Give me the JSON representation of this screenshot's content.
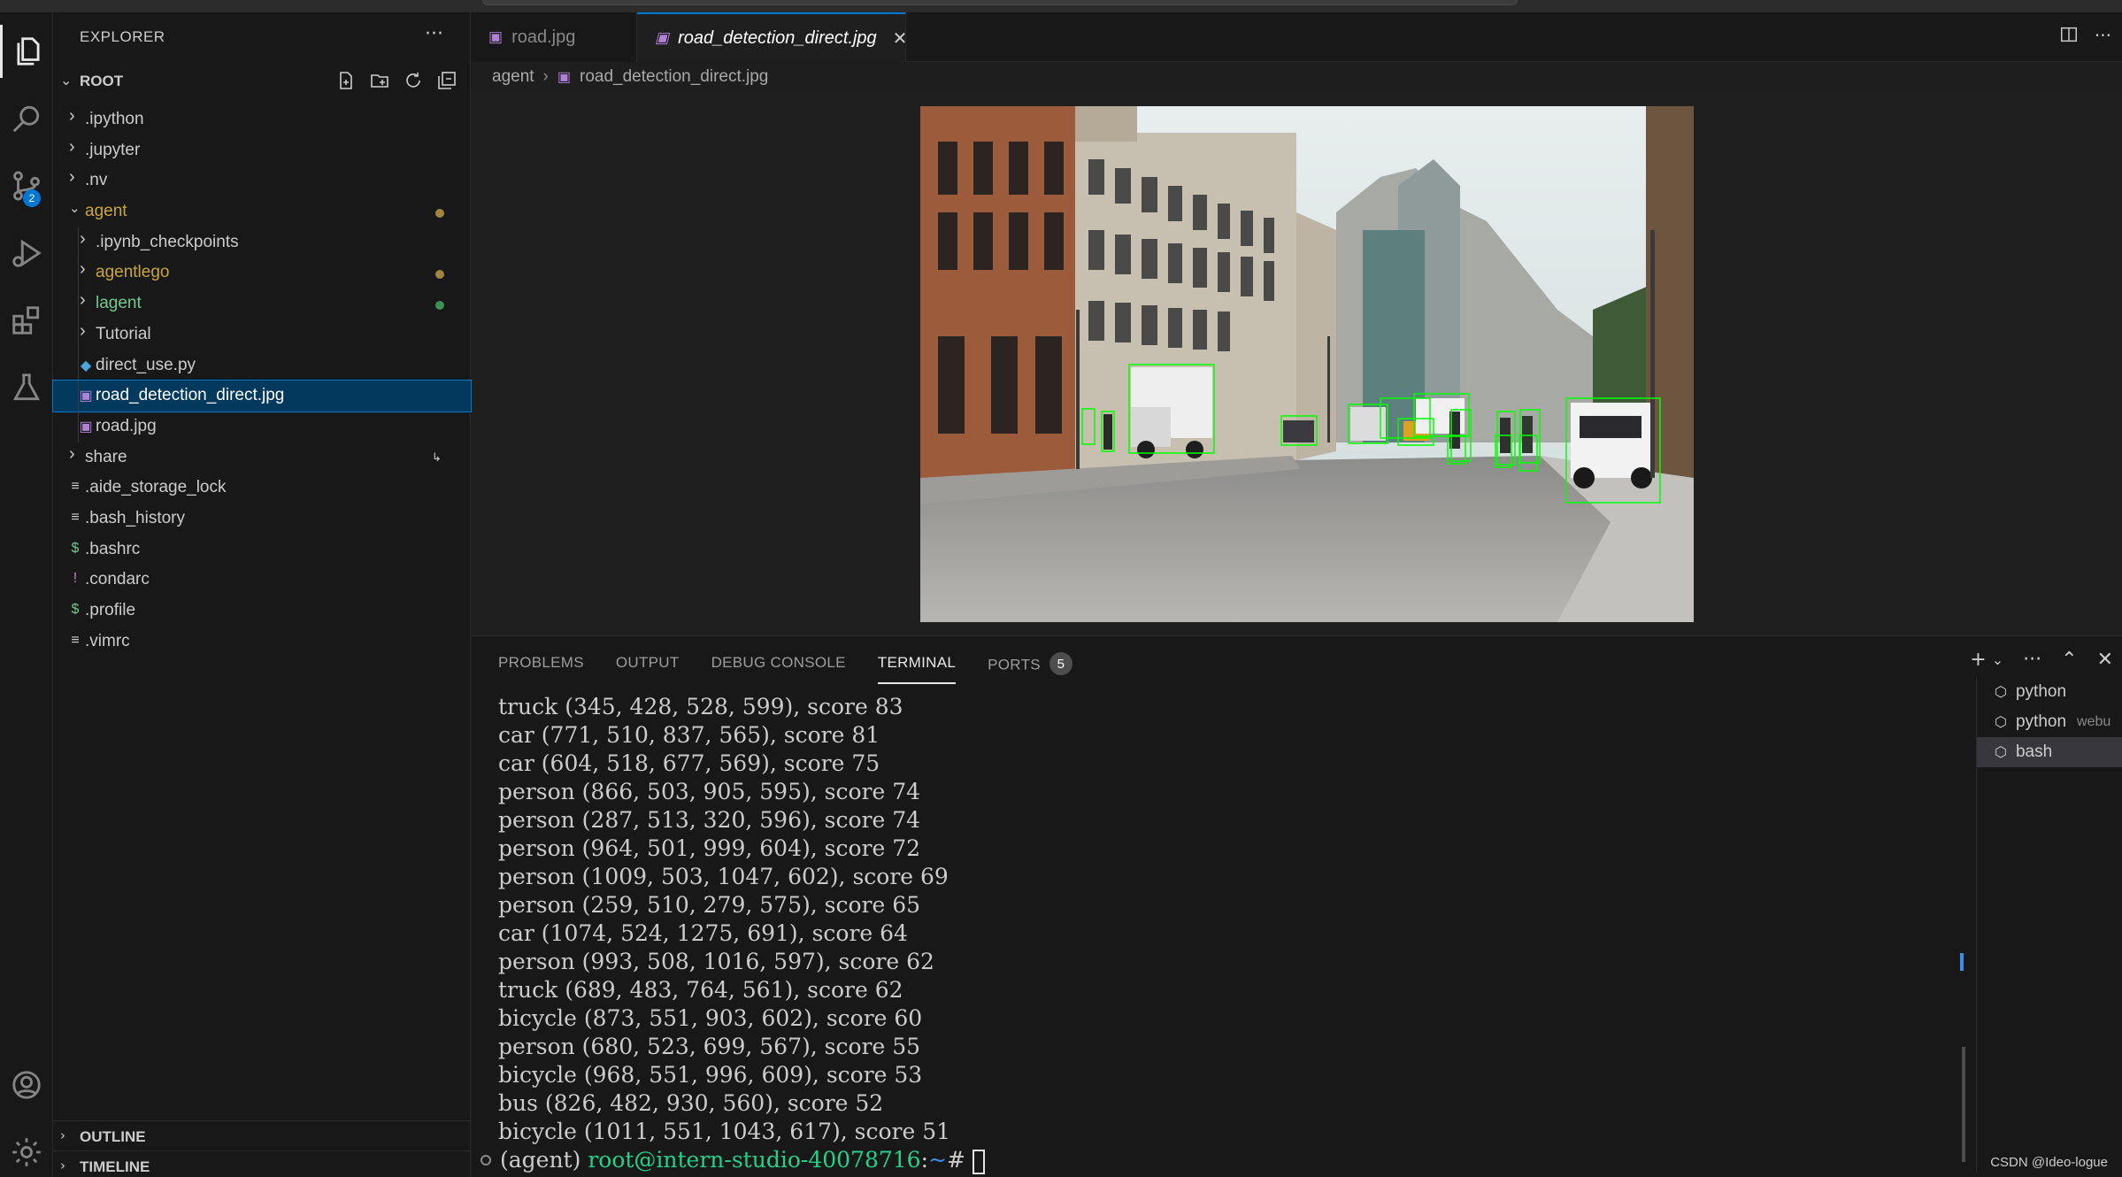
{
  "explorer": {
    "title": "EXPLORER",
    "more": "···",
    "root_label": "ROOT",
    "items": [
      {
        "name": ".ipython",
        "kind": "folder",
        "depth": 0,
        "expanded": false
      },
      {
        "name": ".jupyter",
        "kind": "folder",
        "depth": 0,
        "expanded": false
      },
      {
        "name": ".nv",
        "kind": "folder",
        "depth": 0,
        "expanded": false
      },
      {
        "name": "agent",
        "kind": "folder",
        "depth": 0,
        "expanded": true,
        "color": "#c9a63b",
        "dot": "#a08540"
      },
      {
        "name": ".ipynb_checkpoints",
        "kind": "folder",
        "depth": 1,
        "expanded": false
      },
      {
        "name": "agentlego",
        "kind": "folder",
        "depth": 1,
        "expanded": false,
        "color": "#c9a63b",
        "dot": "#a08540"
      },
      {
        "name": "lagent",
        "kind": "folder",
        "depth": 1,
        "expanded": false,
        "color": "#73c991",
        "dot": "#3f8f57"
      },
      {
        "name": "Tutorial",
        "kind": "folder",
        "depth": 1,
        "expanded": false
      },
      {
        "name": "direct_use.py",
        "kind": "python",
        "depth": 1
      },
      {
        "name": "road_detection_direct.jpg",
        "kind": "image",
        "depth": 1,
        "selected": true
      },
      {
        "name": "road.jpg",
        "kind": "image",
        "depth": 1
      },
      {
        "name": "share",
        "kind": "folder",
        "depth": 0,
        "expanded": false,
        "symlink": true
      },
      {
        "name": ".aide_storage_lock",
        "kind": "text",
        "depth": 0
      },
      {
        "name": ".bash_history",
        "kind": "text",
        "depth": 0
      },
      {
        "name": ".bashrc",
        "kind": "shell",
        "depth": 0
      },
      {
        "name": ".condarc",
        "kind": "yaml",
        "depth": 0
      },
      {
        "name": ".profile",
        "kind": "shell",
        "depth": 0
      },
      {
        "name": ".vimrc",
        "kind": "text",
        "depth": 0
      }
    ],
    "outline_label": "OUTLINE",
    "timeline_label": "TIMELINE"
  },
  "activity": {
    "scm_badge": "2"
  },
  "tabs": [
    {
      "label": "road.jpg",
      "active": false
    },
    {
      "label": "road_detection_direct.jpg",
      "active": true,
      "close": "✕"
    }
  ],
  "breadcrumb": {
    "folder": "agent",
    "file": "road_detection_direct.jpg"
  },
  "panel": {
    "tabs": [
      "PROBLEMS",
      "OUTPUT",
      "DEBUG CONSOLE",
      "TERMINAL",
      "PORTS"
    ],
    "active_tab": "TERMINAL",
    "ports_count": "5"
  },
  "terminal": {
    "lines": [
      "truck (345, 428, 528, 599), score 83",
      "car (771, 510, 837, 565), score 81",
      "car (604, 518, 677, 569), score 75",
      "person (866, 503, 905, 595), score 74",
      "person (287, 513, 320, 596), score 74",
      "person (964, 501, 999, 604), score 72",
      "person (1009, 503, 1047, 602), score 69",
      "person (259, 510, 279, 575), score 65",
      "car (1074, 524, 1275, 691), score 64",
      "person (993, 508, 1016, 597), score 62",
      "truck (689, 483, 764, 561), score 62",
      "bicycle (873, 551, 903, 602), score 60",
      "person (680, 523, 699, 567), score 55",
      "bicycle (968, 551, 996, 609), score 53",
      "bus (826, 482, 930, 560), score 52",
      "bicycle (1011, 551, 1043, 617), score 51"
    ],
    "prompt_env": "(agent)",
    "prompt_user": "root@intern-studio-40078716",
    "prompt_sep": ":",
    "prompt_path": "~",
    "prompt_char": "#"
  },
  "terminal_list": [
    {
      "label": "python",
      "sub": ""
    },
    {
      "label": "python",
      "sub": "webu"
    },
    {
      "label": "bash",
      "sub": "",
      "active": true
    }
  ],
  "watermark": "CSDN @Ideo-logue"
}
